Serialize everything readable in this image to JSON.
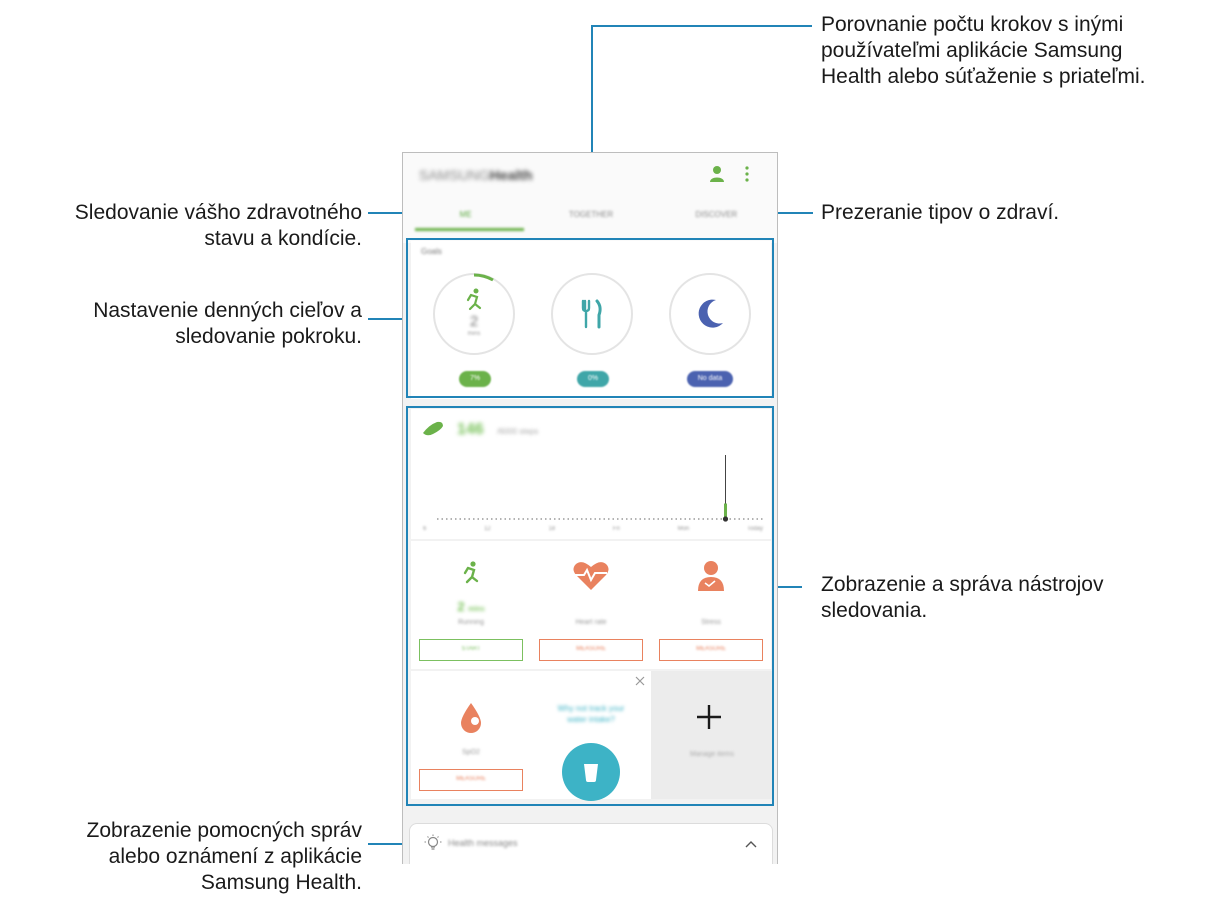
{
  "callouts": {
    "compare_steps": [
      "Porovnanie počtu krokov s inými",
      "používateľmi aplikácie Samsung",
      "Health alebo súťaženie s priateľmi."
    ],
    "track_health": [
      "Sledovanie vášho zdravotného",
      "stavu a kondície."
    ],
    "tips": "Prezeranie tipov o zdraví.",
    "goals": [
      "Nastavenie denných cieľov a",
      "sledovanie pokroku."
    ],
    "trackers": [
      "Zobrazenie a správa nástrojov",
      "sledovania."
    ],
    "messages": [
      "Zobrazenie pomocných správ",
      "alebo oznámení z aplikácie",
      "Samsung Health."
    ]
  },
  "app": {
    "title_prefix": "SAMSUNG",
    "title": "Health",
    "tabs": [
      "ME",
      "TOGETHER",
      "DISCOVER"
    ],
    "active_tab": 0
  },
  "goals": {
    "label": "Goals",
    "items": [
      {
        "name": "activity",
        "value": "2",
        "unit": "mins",
        "pill": "7%",
        "color": "#6bb24a",
        "progress": 0.07
      },
      {
        "name": "food",
        "pill": "0%",
        "color": "#3fa6a8",
        "progress": 0.0
      },
      {
        "name": "sleep",
        "pill": "No data",
        "color": "#4b62b0"
      }
    ]
  },
  "steps": {
    "count": "146",
    "sub": "/6000 steps",
    "axis": [
      "6",
      "12",
      "18",
      "Fri",
      "Mon",
      "Today"
    ],
    "today_fraction": 0.11
  },
  "trackers": [
    {
      "name": "running",
      "value": "2",
      "unit": "mins",
      "label": "Running",
      "button": "START",
      "style": "green"
    },
    {
      "name": "heart-rate",
      "label": "Heart rate",
      "button": "MEASURE",
      "style": "orange"
    },
    {
      "name": "stress",
      "label": "Stress",
      "button": "MEASURE",
      "style": "orange"
    },
    {
      "name": "spo2",
      "label": "SpO2",
      "button": "MEASURE",
      "style": "orange"
    }
  ],
  "water_prompt": [
    "Why not track your",
    "water intake?"
  ],
  "manage": {
    "label": "Manage items",
    "glyph": "+"
  },
  "messages": {
    "label": "Health messages"
  },
  "colors": {
    "accent": "#2184b7",
    "green": "#6bb24a",
    "orange": "#e9825f",
    "teal": "#3db3c6",
    "indigo": "#4b62b0"
  }
}
